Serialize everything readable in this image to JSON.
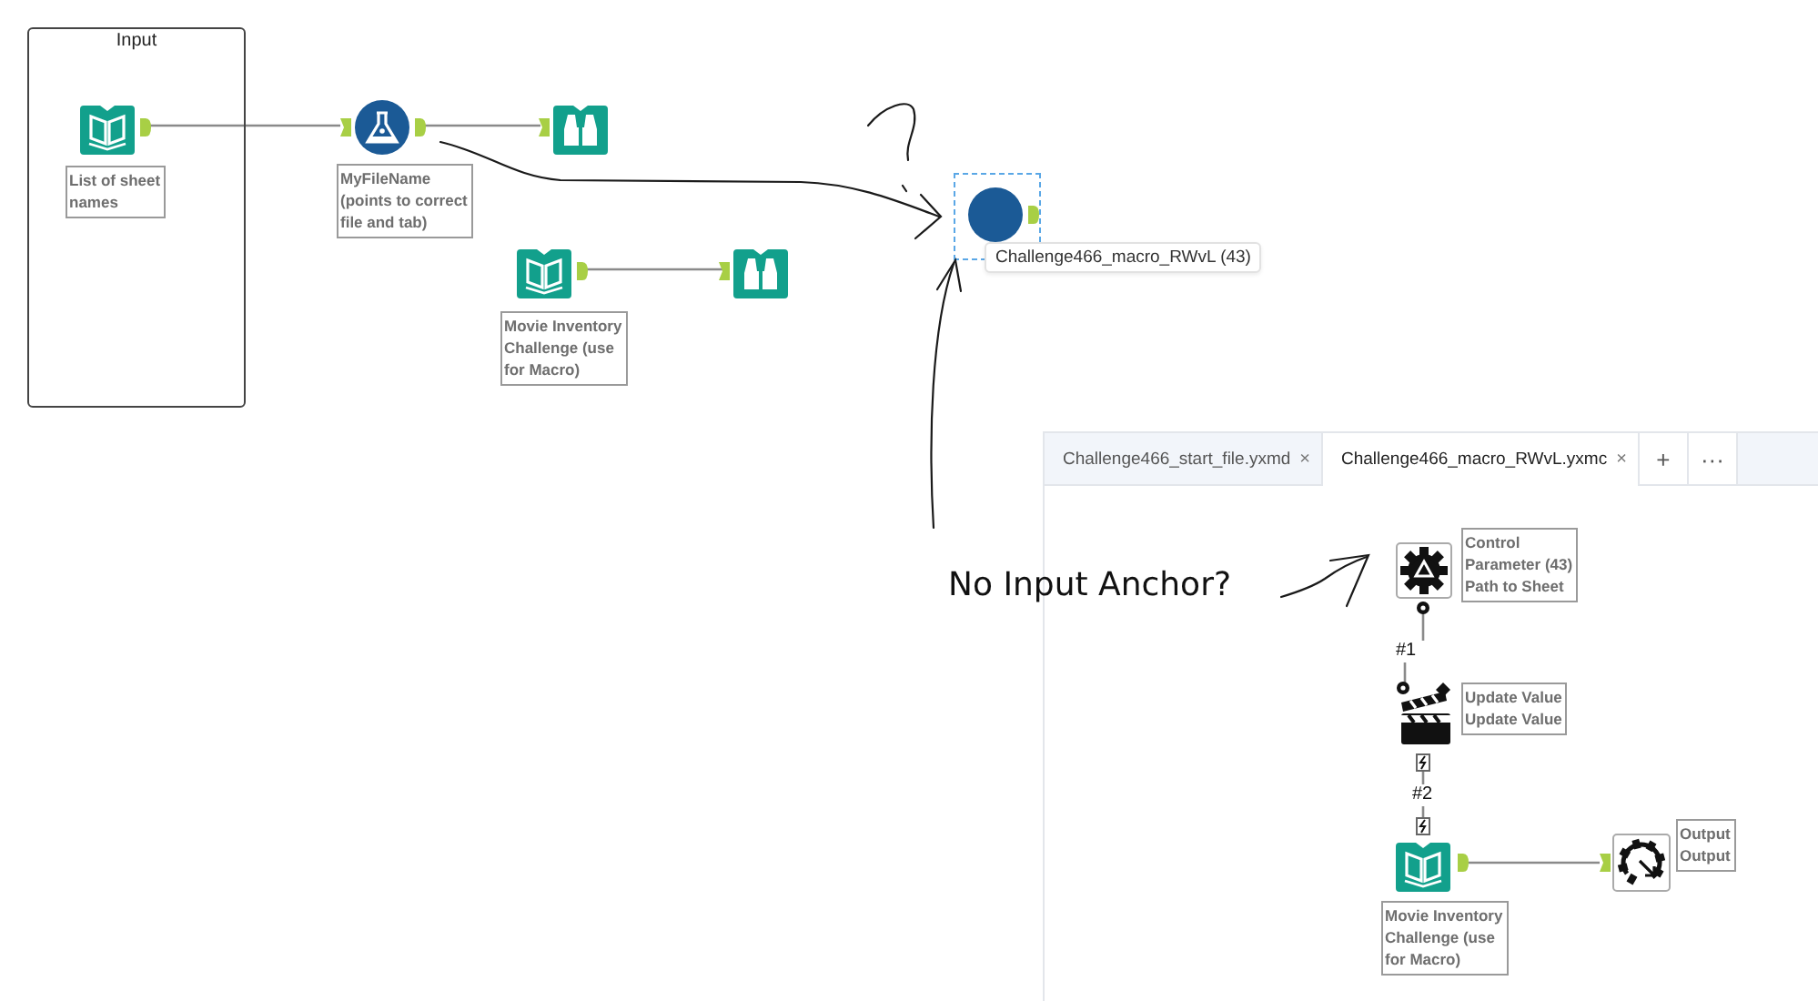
{
  "canvas": {
    "container": {
      "title": "Input"
    },
    "nodes": [
      {
        "kind": "book",
        "label": "List of sheet\nnames"
      },
      {
        "kind": "flask",
        "label": "MyFileName\n(points to correct\nfile and tab)"
      },
      {
        "kind": "binoculars"
      },
      {
        "kind": "book",
        "label": "Movie Inventory\nChallenge (use\nfor Macro)"
      },
      {
        "kind": "binoculars"
      },
      {
        "kind": "macro",
        "selected": true,
        "tooltip": "Challenge466_macro_RWvL (43)"
      }
    ]
  },
  "annotation": "No Input Anchor?",
  "macro_window": {
    "tabs": [
      {
        "label": "Challenge466_start_file.yxmd",
        "close": "×",
        "selected": false
      },
      {
        "label": "Challenge466_macro_RWvL.yxmc",
        "close": "×",
        "selected": true
      }
    ],
    "add": "+",
    "more": "···",
    "nodes": [
      {
        "kind": "control",
        "label": "Control\nParameter (43)\nPath to Sheet"
      },
      {
        "kind": "action",
        "label": "Update Value\nUpdate Value"
      },
      {
        "kind": "book",
        "label": "Movie Inventory\nChallenge (use\nfor Macro)"
      },
      {
        "kind": "output",
        "label": "Output\nOutput"
      }
    ],
    "connection_labels": [
      "#1",
      "#2"
    ]
  }
}
